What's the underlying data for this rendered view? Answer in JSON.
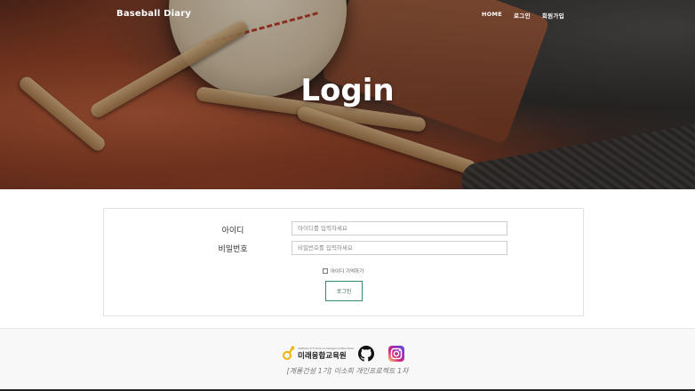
{
  "nav": {
    "brand": "Baseball Diary",
    "items": [
      "HOME",
      "로그인",
      "회원가입"
    ]
  },
  "hero": {
    "title": "Login"
  },
  "form": {
    "id_label": "아이디",
    "id_placeholder": "아이디를 입력하세요",
    "password_label": "비밀번호",
    "password_placeholder": "비밀번호를 입력하세요",
    "remember_label": "아이디 기억하기",
    "remember_checked": false,
    "submit_label": "로그인"
  },
  "footer": {
    "logo_subtitle": "Institute of Future Convergence Education",
    "logo_name": "미래융합교육원",
    "github_icon": "github-icon",
    "instagram_icon": "instagram-icon",
    "note": "[계룡건설 1기] 이소희 개인프로젝트 1차"
  },
  "colors": {
    "accent_green": "#2e8b6b",
    "logo_yellow": "#f0b400",
    "instagram_gradient": [
      "#feda75",
      "#d62976",
      "#962fbf",
      "#4f5bd5"
    ]
  }
}
